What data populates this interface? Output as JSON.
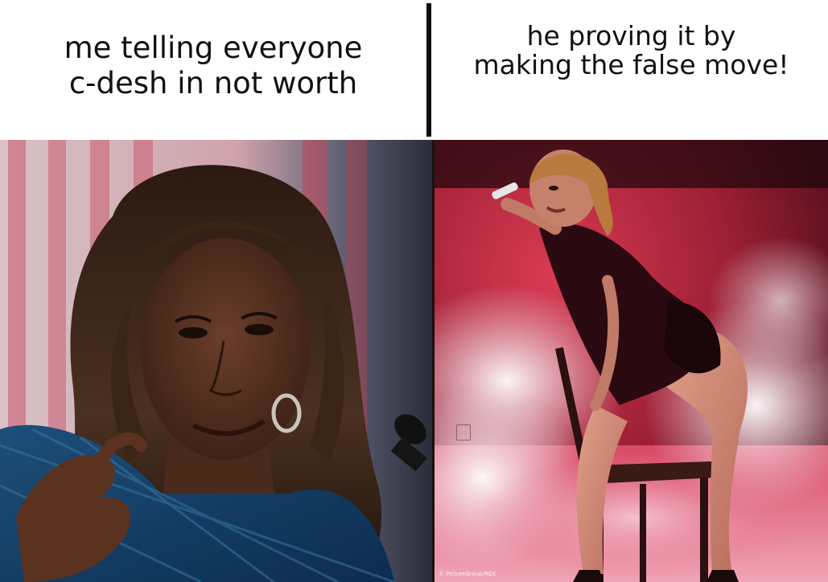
{
  "meme": {
    "left_caption": "me telling everyone\nc-desh in not worth",
    "right_caption": "he proving it by\nmaking the false move!",
    "photo_credit": "© PictureGroup/REX"
  },
  "colors": {
    "background": "#ffffff",
    "caption_text": "#111111",
    "divider": "#0e0e0e",
    "left_backdrop_stripes": "#c9546a",
    "right_stage_red": "#c8283c",
    "right_smoke": "#f3e6ee"
  },
  "icons": {
    "watermark": "app-logo-watermark-icon"
  }
}
